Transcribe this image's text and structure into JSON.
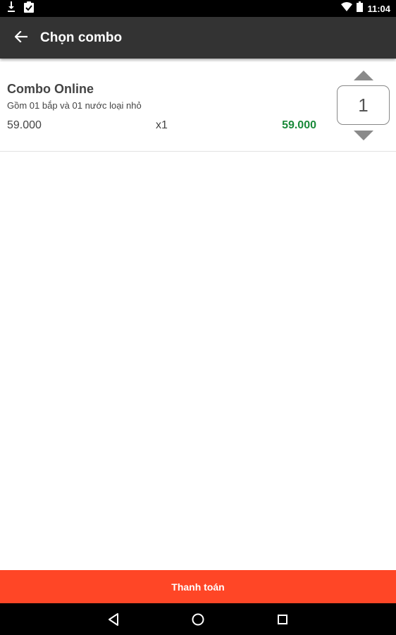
{
  "status_bar": {
    "time": "11:04",
    "icons": [
      "download-icon",
      "clipboard-check-icon",
      "wifi-icon",
      "battery-icon"
    ]
  },
  "app_bar": {
    "title": "Chọn combo",
    "back_icon": "arrow-left-icon"
  },
  "combo": {
    "name": "Combo Online",
    "description": "Gồm 01 bắp và 01 nước loại nhỏ",
    "unit_price": "59.000",
    "quantity_label": "x1",
    "total": "59.000",
    "stepper_value": "1"
  },
  "checkout": {
    "label": "Thanh toán"
  },
  "nav_bar": {
    "icons": [
      "back-triangle-icon",
      "home-circle-icon",
      "recents-square-icon"
    ]
  },
  "colors": {
    "app_bar": "#333333",
    "accent": "#FF4626",
    "price_green": "#1A8A3A",
    "stepper_arrow": "#8A8A8A"
  }
}
